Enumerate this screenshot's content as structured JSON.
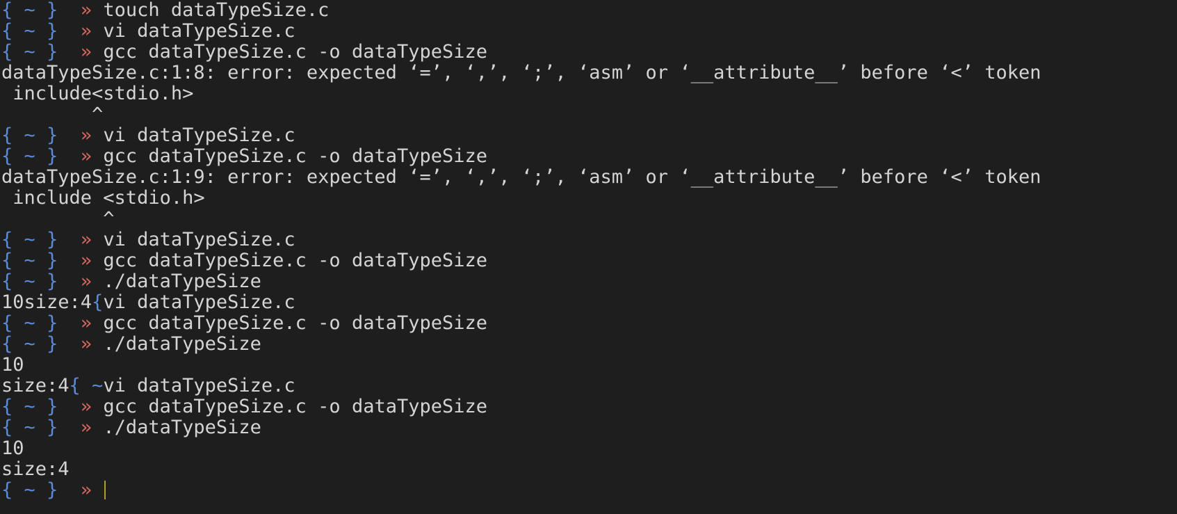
{
  "colors": {
    "background": "#1e1e1e",
    "text": "#d4d4d4",
    "prompt_brace": "#5b8bd6",
    "prompt_arrow": "#d4675e",
    "cursor": "#b59b2e"
  },
  "prompt": {
    "dir": "{ ~ }",
    "arrow": "»"
  },
  "lines": [
    {
      "type": "cmd",
      "cmd": "touch dataTypeSize.c"
    },
    {
      "type": "cmd",
      "cmd": "vi dataTypeSize.c"
    },
    {
      "type": "cmd",
      "cmd": "gcc dataTypeSize.c -o dataTypeSize"
    },
    {
      "type": "out",
      "text": "dataTypeSize.c:1:8: error: expected ‘=’, ‘,’, ‘;’, ‘asm’ or ‘__attribute__’ before ‘<’ token"
    },
    {
      "type": "out",
      "text": " include<stdio.h>"
    },
    {
      "type": "out",
      "text": "        ^"
    },
    {
      "type": "cmd",
      "cmd": "vi dataTypeSize.c"
    },
    {
      "type": "cmd",
      "cmd": "gcc dataTypeSize.c -o dataTypeSize"
    },
    {
      "type": "out",
      "text": "dataTypeSize.c:1:9: error: expected ‘=’, ‘,’, ‘;’, ‘asm’ or ‘__attribute__’ before ‘<’ token"
    },
    {
      "type": "out",
      "text": " include <stdio.h>"
    },
    {
      "type": "out",
      "text": "         ^"
    },
    {
      "type": "cmd",
      "cmd": "vi dataTypeSize.c"
    },
    {
      "type": "cmd",
      "cmd": "gcc dataTypeSize.c -o dataTypeSize"
    },
    {
      "type": "cmd",
      "cmd": "./dataTypeSize"
    },
    {
      "type": "mixed",
      "out": "10size:4",
      "brace": "{",
      "cmd": "vi dataTypeSize.c"
    },
    {
      "type": "cmd",
      "cmd": "gcc dataTypeSize.c -o dataTypeSize"
    },
    {
      "type": "cmd",
      "cmd": "./dataTypeSize"
    },
    {
      "type": "out",
      "text": "10"
    },
    {
      "type": "mixed",
      "out": "size:4",
      "brace": "{ ~",
      "cmd": "vi dataTypeSize.c"
    },
    {
      "type": "cmd",
      "cmd": "gcc dataTypeSize.c -o dataTypeSize"
    },
    {
      "type": "cmd",
      "cmd": "./dataTypeSize"
    },
    {
      "type": "out",
      "text": "10"
    },
    {
      "type": "out",
      "text": "size:4"
    },
    {
      "type": "cursor"
    }
  ]
}
